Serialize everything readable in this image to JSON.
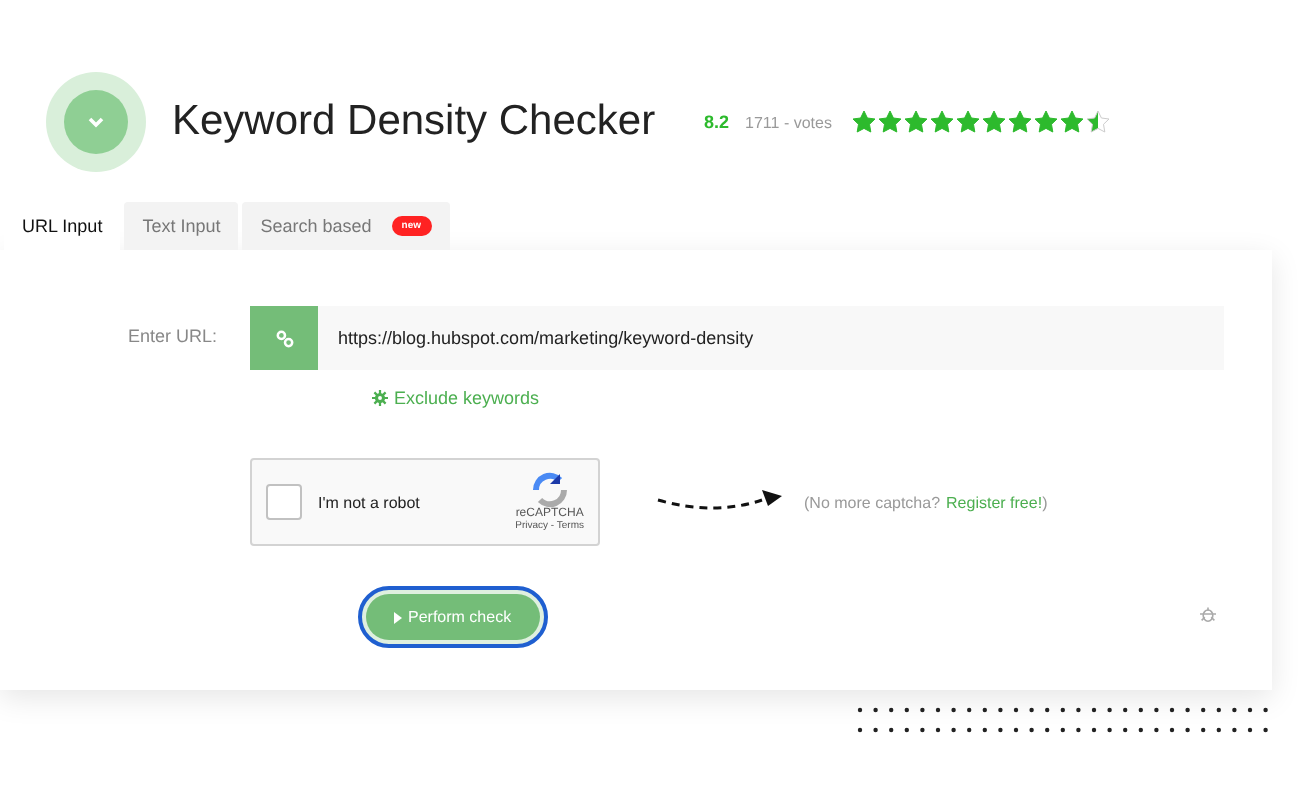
{
  "header": {
    "title": "Keyword Density Checker",
    "score": "8.2",
    "votes": "1711 - votes",
    "stars": 9.5
  },
  "tabs": [
    {
      "label": "URL Input",
      "selected": true
    },
    {
      "label": "Text Input",
      "selected": false
    },
    {
      "label": "Search based",
      "selected": false,
      "badge": "new"
    }
  ],
  "form": {
    "url_label": "Enter URL:",
    "url_value": "https://blog.hubspot.com/marketing/keyword-density",
    "exclude_link": "Exclude keywords",
    "captcha": {
      "label": "I'm not a robot",
      "checked": false,
      "brand": "reCAPTCHA",
      "links": "Privacy - Terms"
    },
    "captcha_note": "(No more captcha? ",
    "register_link": "Register free!",
    "captcha_note_end": ")",
    "submit": "Perform check"
  }
}
